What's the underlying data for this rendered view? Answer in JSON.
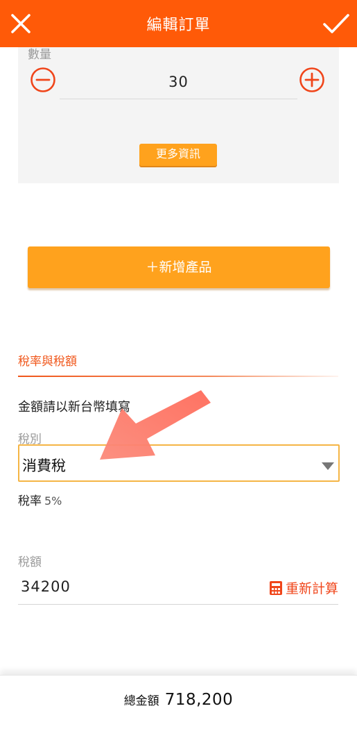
{
  "app_bar": {
    "title": "編輯訂單",
    "close_icon": "close-icon",
    "confirm_icon": "check-icon",
    "color": "#ff5a08"
  },
  "product_card": {
    "quantity_label": "數量",
    "quantity_value": "30",
    "decrement_icon": "minus-circle-icon",
    "increment_icon": "plus-circle-icon",
    "more_info_label": "更多資訊"
  },
  "add_product_label": "＋新增產品",
  "tax": {
    "section_title": "稅率與稅額",
    "currency_note": "金額請以新台幣填寫",
    "tax_type_label": "稅別",
    "tax_type_value": "消費稅",
    "tax_rate_label": "稅率",
    "tax_rate_value": "5%",
    "tax_amount_label": "稅額",
    "tax_amount_value": "34200",
    "recalc_label": "重新計算",
    "recalc_icon": "calculator-icon"
  },
  "footer": {
    "total_label": "總金額",
    "total_value": "718,200"
  },
  "colors": {
    "accent_orange": "#ff5a08",
    "button_orange": "#ffa21d",
    "section_red": "#f0561a"
  }
}
